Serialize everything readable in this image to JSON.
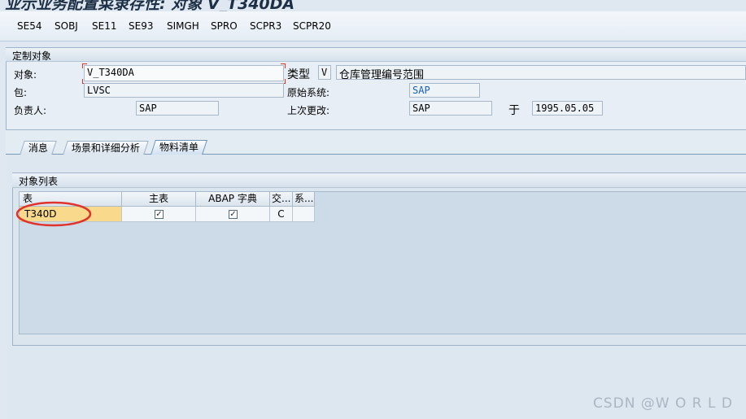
{
  "window": {
    "title": "业示业务配置菜隶存性: 对象 V_T340DA"
  },
  "toolbar": {
    "buttons": [
      "SE54",
      "SOBJ",
      "SE11",
      "SE93",
      "SIMGH",
      "SPRO",
      "SCPR3",
      "SCPR20"
    ]
  },
  "custom_object": {
    "title": "定制对象",
    "object_label": "对象:",
    "object_value": "V_T340DA",
    "type_label": "类型",
    "type_value": "V",
    "type_desc": "仓库管理编号范围",
    "package_label": "包:",
    "package_value": "LVSC",
    "orig_system_label": "原始系统:",
    "orig_system_value": "SAP",
    "owner_label": "负责人:",
    "owner_value": "SAP",
    "last_change_label": "上次更改:",
    "last_change_value": "SAP",
    "on_label": "于",
    "date_value": "1995.05.05"
  },
  "tabs": [
    {
      "label": "消息",
      "active": false
    },
    {
      "label": "场景和详细分析",
      "active": false
    },
    {
      "label": "物料清单",
      "active": true
    }
  ],
  "object_list": {
    "title": "对象列表",
    "columns": [
      "表",
      "主表",
      "ABAP 字典",
      "交...",
      "系..."
    ],
    "rows": [
      {
        "table": "T340D",
        "main_table": true,
        "abap_dict": true,
        "trans": "C",
        "sys": ""
      }
    ]
  },
  "watermark": "CSDN @W O R L D",
  "colors": {
    "highlight_cell": "#f9d98c",
    "annotation_circle": "#e0332b"
  }
}
